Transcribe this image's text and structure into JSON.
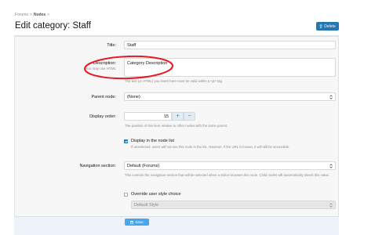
{
  "breadcrumb": {
    "item1": "Forums",
    "sep": ">",
    "item2": "Nodes"
  },
  "page_title": "Edit category: Staff",
  "delete_label": "Delete",
  "fields": {
    "title": {
      "label": "Title:",
      "value": "Staff"
    },
    "description": {
      "label": "Description:",
      "sublabel": "You may use HTML",
      "value": "Category Description",
      "hint": "The text (or HTML) you insert here must be valid within a <p> tag."
    },
    "parent_node": {
      "label": "Parent node:",
      "value": "(None)"
    },
    "display_order": {
      "label": "Display order:",
      "value": "15",
      "plus": "+",
      "minus": "−",
      "hint": "The position of this item relative to other nodes with the same parent."
    },
    "display_in_list": {
      "label": "Display in the node list",
      "checked": true,
      "hint": "If unselected, users will not see this node in the list. However, if the URL is known, it will still be accessible."
    },
    "navigation_section": {
      "label": "Navigation section:",
      "value": "Default (Forums)",
      "hint": "This controls the navigation section that will be selected when a visitor browses this node. Child nodes will automatically inherit this value."
    },
    "override_style": {
      "label": "Override user style choice",
      "checked": false,
      "value": "Default Style"
    }
  },
  "save_label": "Save",
  "colors": {
    "accent": "#2577b1",
    "save": "#47a7eb",
    "annotation": "#e31b23"
  },
  "icons": [
    "trash-icon",
    "chevron-updown-icon",
    "save-icon"
  ]
}
